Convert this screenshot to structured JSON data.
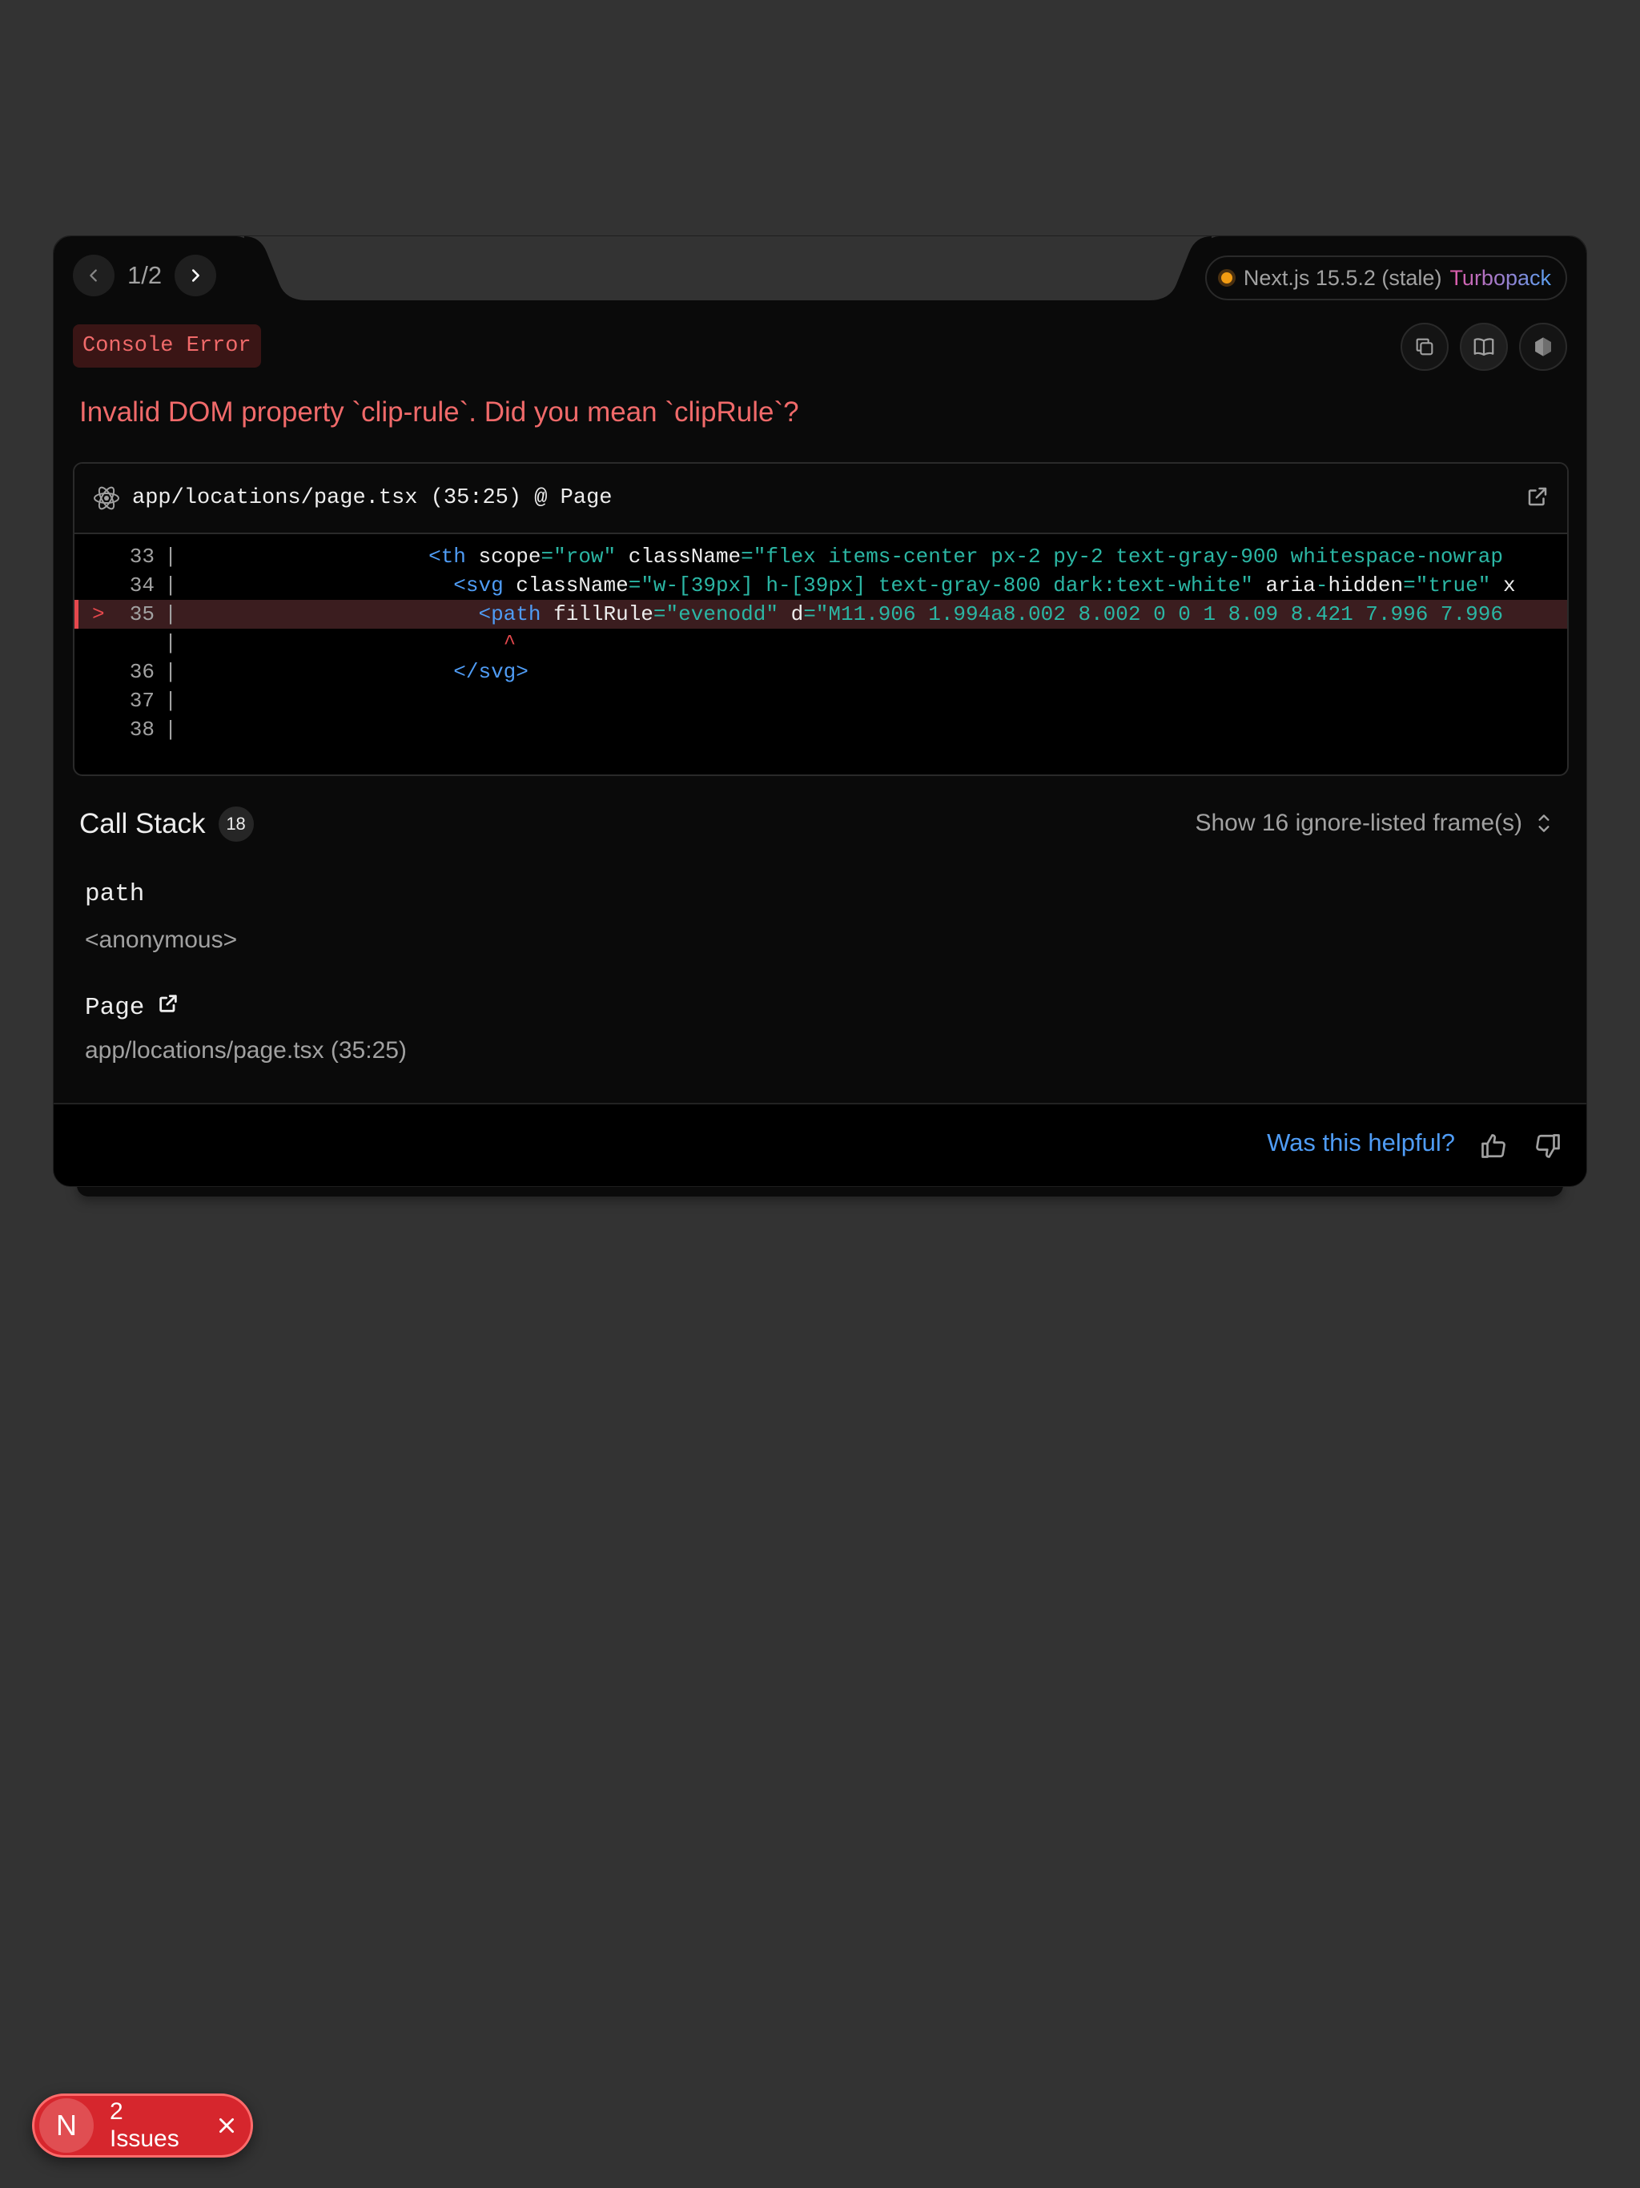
{
  "header": {
    "page_counter": "1/2",
    "version_text": "Next.js 15.5.2 (stale)",
    "bundler": "Turbopack"
  },
  "error": {
    "badge": "Console Error",
    "message": "Invalid DOM property `clip-rule`. Did you mean `clipRule`?"
  },
  "codeframe": {
    "file": "app/locations/page.tsx (35:25) @ Page",
    "lines": [
      {
        "num": "33",
        "marker": "",
        "pipe": "|",
        "indent": "                    ",
        "segments": [
          {
            "t": "tag",
            "v": "<th"
          },
          {
            "t": "attr",
            "v": " scope"
          },
          {
            "t": "eq",
            "v": "="
          },
          {
            "t": "str",
            "v": "\"row\""
          },
          {
            "t": "attr",
            "v": " className"
          },
          {
            "t": "eq",
            "v": "="
          },
          {
            "t": "str",
            "v": "\"flex items-center px-2 py-2 text-gray-900 whitespace-nowrap"
          }
        ]
      },
      {
        "num": "34",
        "marker": "",
        "pipe": "|",
        "indent": "                      ",
        "segments": [
          {
            "t": "tag",
            "v": "<svg"
          },
          {
            "t": "attr",
            "v": " className"
          },
          {
            "t": "eq",
            "v": "="
          },
          {
            "t": "str",
            "v": "\"w-[39px] h-[39px] text-gray-800 dark:text-white\""
          },
          {
            "t": "attr",
            "v": " aria"
          },
          {
            "t": "eq",
            "v": "-"
          },
          {
            "t": "attr",
            "v": "hidden"
          },
          {
            "t": "eq",
            "v": "="
          },
          {
            "t": "str",
            "v": "\"true\""
          },
          {
            "t": "attr",
            "v": " x"
          }
        ]
      },
      {
        "num": "35",
        "marker": ">",
        "pipe": "|",
        "indent": "                        ",
        "segments": [
          {
            "t": "tag",
            "v": "<path"
          },
          {
            "t": "attr",
            "v": " fillRule"
          },
          {
            "t": "eq",
            "v": "="
          },
          {
            "t": "str",
            "v": "\"evenodd\""
          },
          {
            "t": "attr",
            "v": " d"
          },
          {
            "t": "eq",
            "v": "="
          },
          {
            "t": "str",
            "v": "\"M11.906 1.994a8.002 8.002 0 0 1 8.09 8.421 7.996 7.996"
          }
        ]
      },
      {
        "num": "",
        "marker": "",
        "pipe": "|",
        "indent": "                          ",
        "segments": [
          {
            "t": "caret",
            "v": "^"
          }
        ]
      },
      {
        "num": "36",
        "marker": "",
        "pipe": "|",
        "indent": "                      ",
        "segments": [
          {
            "t": "tag",
            "v": "</svg>"
          }
        ]
      },
      {
        "num": "37",
        "marker": "",
        "pipe": "|",
        "indent": "",
        "segments": []
      },
      {
        "num": "38",
        "marker": "",
        "pipe": "|",
        "indent": "",
        "segments": []
      }
    ]
  },
  "call_stack": {
    "title": "Call Stack",
    "count": "18",
    "toggle_label": "Show 16 ignore-listed frame(s)",
    "frames": [
      {
        "name": "path",
        "location": "<anonymous>"
      },
      {
        "name": "Page",
        "location": "app/locations/page.tsx (35:25)"
      }
    ]
  },
  "footer": {
    "helpful": "Was this helpful?"
  },
  "issues": {
    "logo": "N",
    "label": "2 Issues"
  },
  "colors": {
    "error_red": "#f06a6a",
    "link_blue": "#4f9cf5",
    "code_string": "#2bb6a4",
    "stale_orange": "#f39c12",
    "issues_bg": "#d6262d"
  }
}
